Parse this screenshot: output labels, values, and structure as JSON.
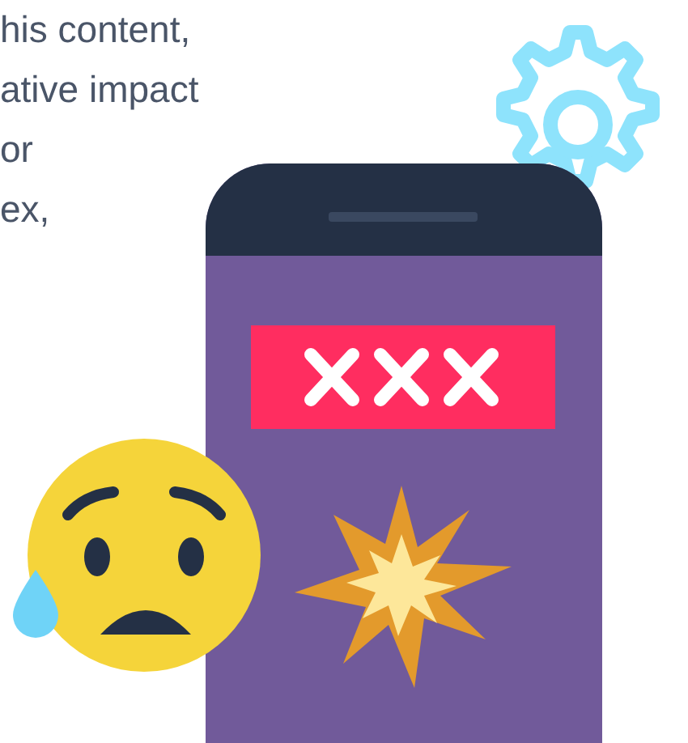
{
  "paragraph": {
    "lines": [
      "his content,",
      "ative impact",
      "or",
      "ex,"
    ]
  }
}
